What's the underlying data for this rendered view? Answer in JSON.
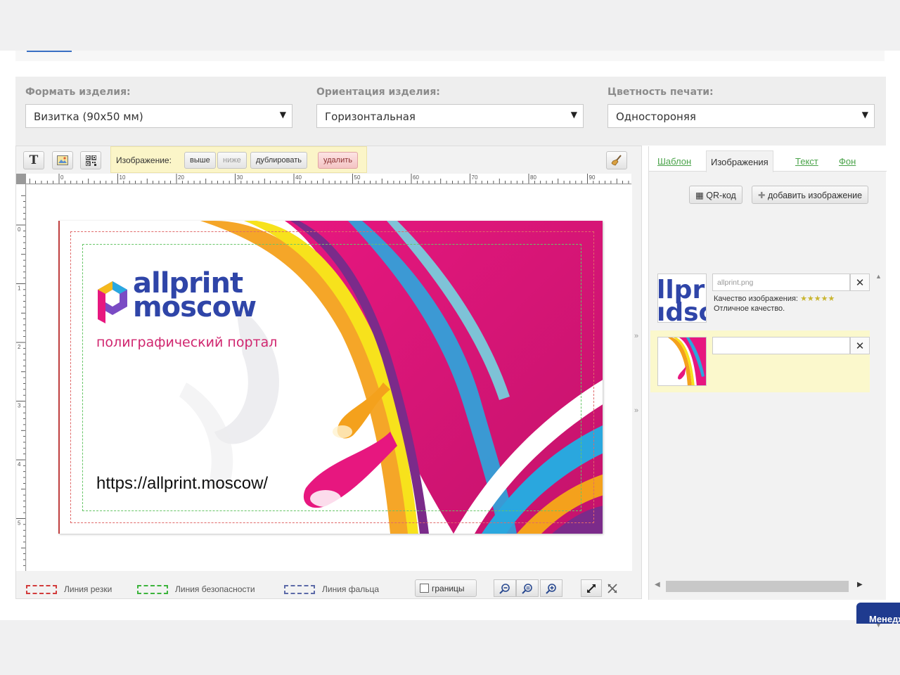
{
  "params": {
    "format": {
      "label": "Формать изделия:",
      "value": "Визитка (90х50 мм)"
    },
    "orientation": {
      "label": "Ориентация изделия:",
      "value": "Горизонтальная"
    },
    "color": {
      "label": "Цветность печати:",
      "value": "Одностороняя"
    }
  },
  "toolbar": {
    "text_tool_glyph": "T",
    "image_label": "Изображение:",
    "up_label": "выше",
    "down_label": "ниже",
    "duplicate_label": "дублировать",
    "delete_label": "удалить"
  },
  "ruler": {
    "h_ticks": [
      "0",
      "10",
      "20",
      "30",
      "40",
      "50",
      "60",
      "70",
      "80",
      "90"
    ],
    "v_ticks": [
      "0",
      "1",
      "2",
      "3",
      "4",
      "5"
    ]
  },
  "card": {
    "logo_line1": "allprint",
    "logo_line2": "moscow",
    "tagline": "полиграфический портал",
    "url": "https://allprint.moscow/"
  },
  "legend": {
    "cut": "Линия резки",
    "safety": "Линия безопасности",
    "fold": "Линия фальца"
  },
  "bottom": {
    "borders_label": "границы"
  },
  "side": {
    "tabs": [
      "Шаблон",
      "Изображения",
      "Текст",
      "Фон"
    ],
    "active_tab": "Изображения",
    "qr_label": "QR-код",
    "add_image_label": "добавить изображение",
    "images": [
      {
        "name": "allprint.png",
        "quality_label": "Качество изображения:",
        "quality_stars": 5,
        "quality_text": "Отличное качество."
      },
      {
        "name": ""
      }
    ]
  },
  "chat": {
    "label": "Менеджер"
  },
  "colors": {
    "cut_line": "#e06a6a",
    "safe_line": "#67c567",
    "fold_line": "#5c6aa8",
    "logo_blue": "#2f45a8",
    "logo_pink": "#d0266f",
    "accent_green": "#4aa34a"
  }
}
